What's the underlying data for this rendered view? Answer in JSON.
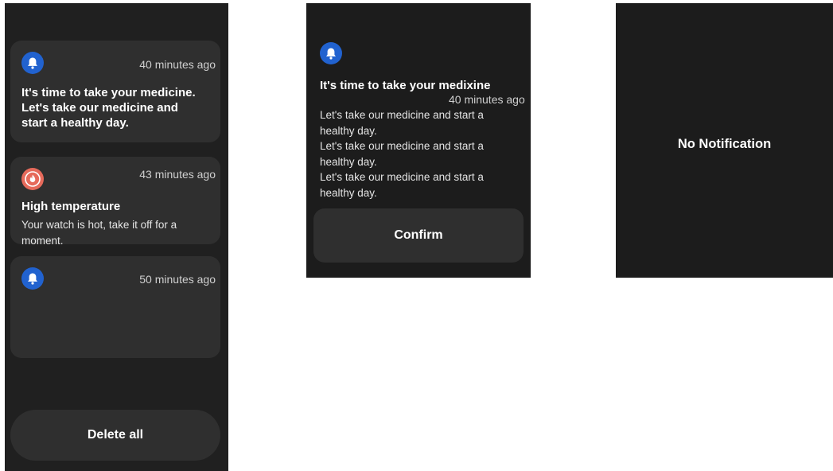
{
  "colors": {
    "screen_bg": "#1f1f1f",
    "card_bg": "#2f2f2f",
    "bell_icon_bg": "#2162cf",
    "alert_icon_bg": "#e66a5b"
  },
  "list_screen": {
    "notifications": [
      {
        "icon": "bell-icon",
        "time": "40 minutes ago",
        "title_lines": [
          "It's time to take your medicine.",
          "Let's take our medicine and",
          "start a healthy day."
        ]
      },
      {
        "icon": "fire-icon",
        "time": "43 minutes ago",
        "title": "High temperature",
        "body_lines": [
          "Your watch is hot, take it off for a",
          "moment."
        ]
      },
      {
        "icon": "bell-icon",
        "time": "50 minutes ago"
      }
    ],
    "delete_all_label": "Delete all"
  },
  "detail_screen": {
    "icon": "bell-icon",
    "title": "It's time to take your medixine",
    "time": "40 minutes ago",
    "body_lines": [
      "Let's take our medicine and start a",
      "healthy day.",
      "Let's take our medicine and start a",
      "healthy day.",
      "Let's take our medicine and start a",
      "healthy day."
    ],
    "confirm_label": "Confirm"
  },
  "empty_screen": {
    "message": "No Notification"
  }
}
